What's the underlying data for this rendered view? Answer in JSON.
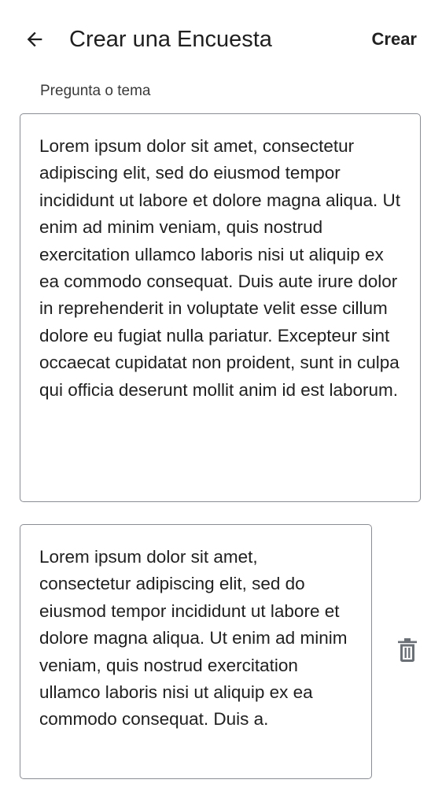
{
  "header": {
    "back_icon": "arrow-left-icon",
    "title": "Crear una Encuesta",
    "action_label": "Crear"
  },
  "question": {
    "label": "Pregunta o tema",
    "value": "Lorem ipsum dolor sit amet, consectetur adipiscing elit, sed do eiusmod tempor incididunt ut labore et dolore magna aliqua. Ut enim ad minim veniam, quis nostrud exercitation ullamco laboris nisi ut aliquip ex ea commodo consequat. Duis aute irure dolor in reprehenderit in voluptate velit esse cillum dolore eu fugiat nulla pariatur. Excepteur sint occaecat cupidatat non proident, sunt in culpa qui officia deserunt mollit anim id est laborum."
  },
  "options": [
    {
      "value": "Lorem ipsum dolor sit amet, consectetur adipiscing elit, sed do eiusmod tempor incididunt ut labore et dolore magna aliqua. Ut enim ad minim veniam, quis nostrud exercitation ullamco laboris nisi ut aliquip ex ea commodo consequat. Duis a.",
      "delete_icon": "trash-icon"
    }
  ],
  "colors": {
    "text": "#1f1f1f",
    "border": "#8a8d93",
    "icon": "#6b7077",
    "background": "#ffffff"
  }
}
